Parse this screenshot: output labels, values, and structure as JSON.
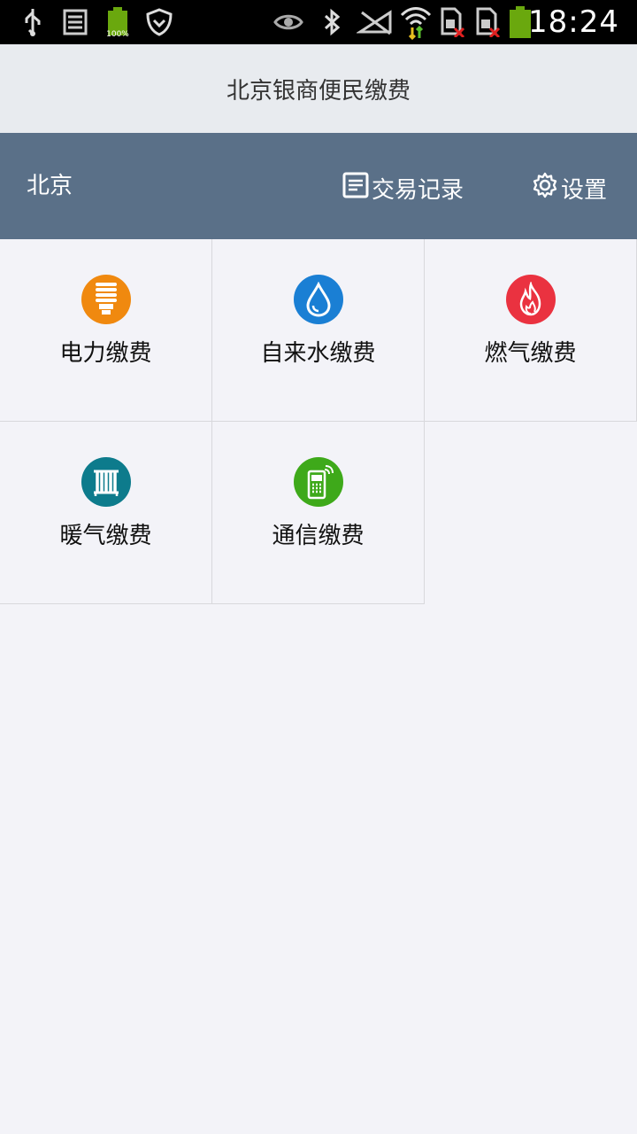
{
  "status_bar": {
    "time": "18:24",
    "battery_small_label": "100%",
    "icons": [
      "usb-icon",
      "storage-icon",
      "battery-full-icon",
      "shield-icon",
      "eye-icon",
      "bluetooth-icon",
      "signal-off-icon",
      "wifi-icon",
      "sim1-off-icon",
      "sim2-off-icon",
      "battery-icon"
    ]
  },
  "header": {
    "title": "北京银商便民缴费"
  },
  "action_bar": {
    "city": "北京",
    "records_label": "交易记录",
    "settings_label": "设置"
  },
  "services": [
    {
      "label": "电力缴费",
      "icon": "lightbulb-icon",
      "color": "#f0890f"
    },
    {
      "label": "自来水缴费",
      "icon": "water-drop-icon",
      "color": "#1a7fd4"
    },
    {
      "label": "燃气缴费",
      "icon": "flame-icon",
      "color": "#ea3240"
    },
    {
      "label": "暖气缴费",
      "icon": "radiator-icon",
      "color": "#0d7b8c"
    },
    {
      "label": "通信缴费",
      "icon": "phone-icon",
      "color": "#3ea91a"
    }
  ]
}
